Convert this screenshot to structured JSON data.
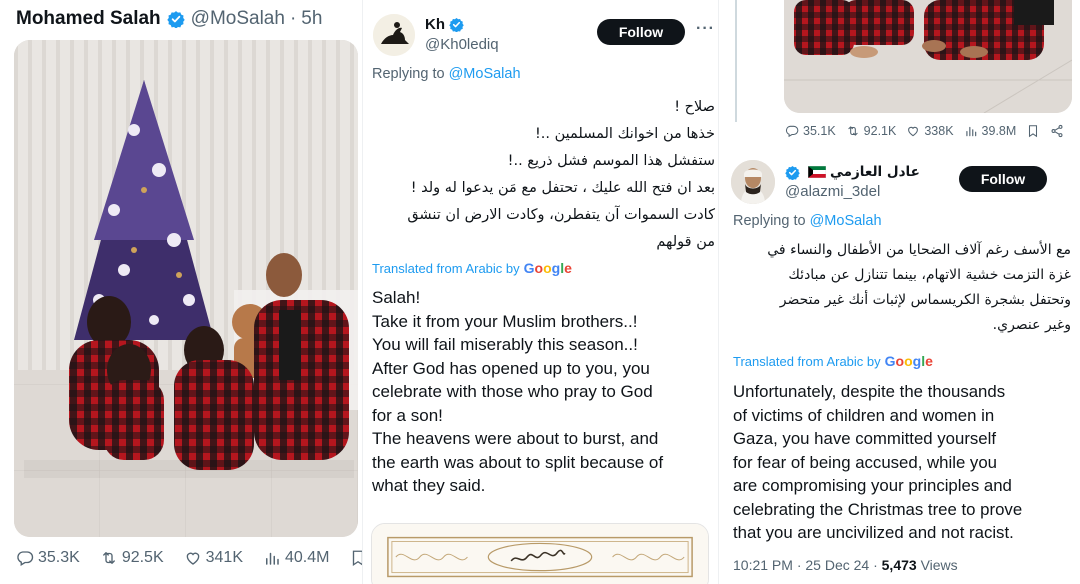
{
  "colors": {
    "accent": "#1d9bf0",
    "text": "#0f1419",
    "muted": "#536471",
    "button_bg": "#0f1419"
  },
  "panel1": {
    "author_name": "Mohamed Salah",
    "handle": "@MoSalah",
    "separator": "·",
    "time": "5h",
    "actions": {
      "replies": "35.3K",
      "reposts": "92.5K",
      "likes": "341K",
      "views": "40.4M"
    }
  },
  "panel2": {
    "author_name": "Kh",
    "handle": "@Kh0lediq",
    "follow_label": "Follow",
    "more_label": "···",
    "replying_prefix": "Replying to",
    "replying_to": "@MoSalah",
    "arabic_lines": [
      "صلاح !",
      "خذها من اخوانك المسلمين ..!",
      "ستفشل هذا الموسم فشل ذريع ..!",
      "بعد ان فتح الله عليك ، تحتفل مع مَن يدعوا له ولد !",
      "كادت السموات آن يتفطرن، وكادت الارض ان تنشق",
      "من قولهم"
    ],
    "translated_label": "Translated from Arabic by",
    "translation_provider": "Google",
    "english_lines": [
      "Salah!",
      "Take it from your Muslim brothers..!",
      "You will fail miserably this season..!",
      "After God has opened up to you, you",
      "celebrate with those who pray to God",
      "for a son!",
      "The heavens were about to burst, and",
      "the earth was about to split because of",
      "what they said."
    ]
  },
  "panel3": {
    "actions": {
      "replies": "35.1K",
      "reposts": "92.1K",
      "likes": "338K",
      "views": "39.8M"
    },
    "author_name": "عادل العازمي",
    "handle": "@alazmi_3del",
    "follow_label": "Follow",
    "replying_prefix": "Replying to",
    "replying_to": "@MoSalah",
    "arabic_lines": [
      "مع الأسف رغم آلاف الضحايا من الأطفال والنساء في",
      "غزة التزمت خشية الاتهام، بينما تتنازل عن مبادئك",
      "وتحتفل بشجرة الكريسماس لإثبات أنك غير متحضر",
      "وغير عنصري."
    ],
    "translated_label": "Translated from Arabic by",
    "translation_provider": "Google",
    "english_lines": [
      "Unfortunately, despite the thousands",
      "of victims of children and women in",
      "Gaza, you have committed yourself",
      "for fear of being accused, while you",
      "are compromising your principles and",
      "celebrating the Christmas tree to prove",
      "that you are uncivilized and not racist."
    ],
    "timestamp": "10:21 PM · 25 Dec 24 ·",
    "views_count": "5,473",
    "views_label": "Views"
  }
}
